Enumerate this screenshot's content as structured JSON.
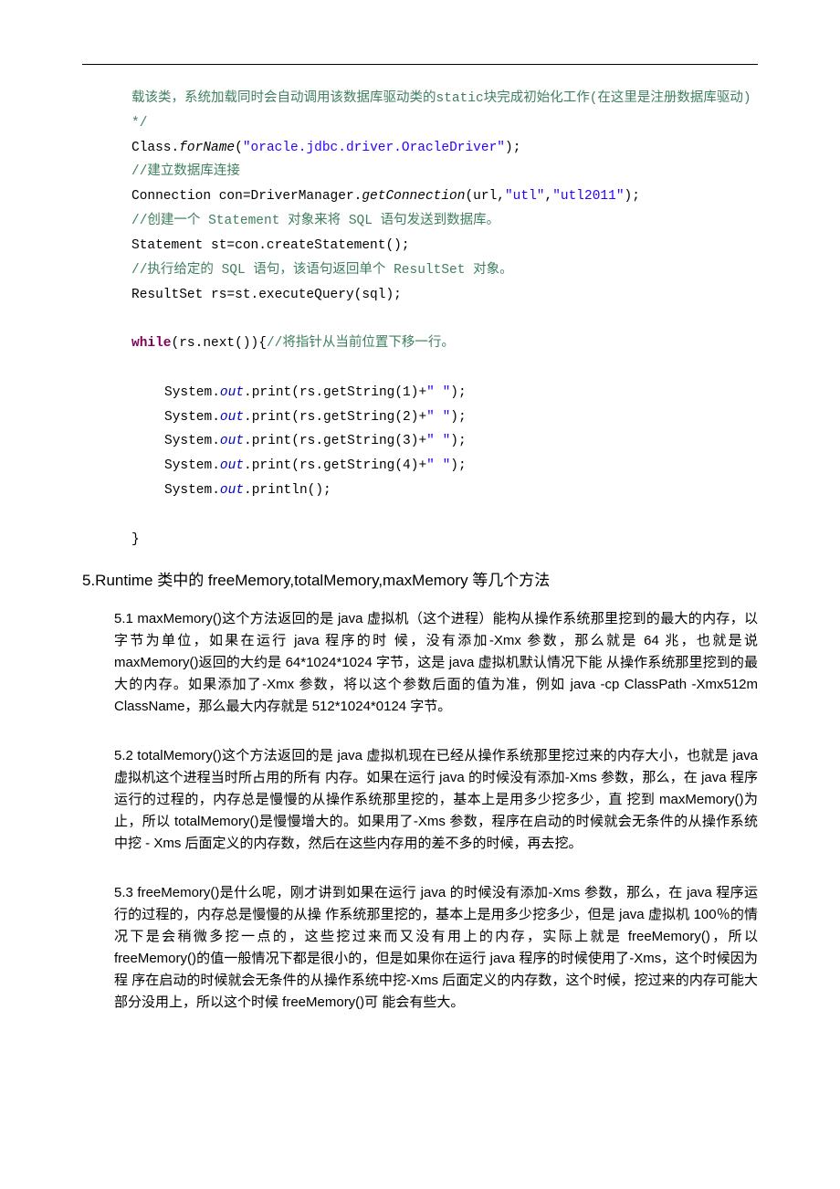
{
  "code": {
    "c1_a": "载该类，系统加载同时会自动调用该数据库驱动类的",
    "c1_b": "static",
    "c1_c": "块完成初始化工作(在这里是注册数据库驱动) */",
    "c2_a": "Class.",
    "c2_b": "forName",
    "c2_c": "(",
    "c2_d": "\"oracle.jdbc.driver.OracleDriver\"",
    "c2_e": ");",
    "c3": "//建立数据库连接",
    "c4_a": "Connection con=DriverManager.",
    "c4_b": "getConnection",
    "c4_c": "(url,",
    "c4_d": "\"utl\"",
    "c4_e": ",",
    "c4_f": "\"utl2011\"",
    "c4_g": ");",
    "c5": "//创建一个 Statement 对象来将 SQL 语句发送到数据库。",
    "c6": "Statement st=con.createStatement();",
    "c7": "//执行给定的 SQL 语句，该语句返回单个 ResultSet 对象。",
    "c8": "ResultSet rs=st.executeQuery(sql);",
    "c9_a": "while",
    "c9_b": "(rs.next()){",
    "c9_c": "//将指针从当前位置下移一行。",
    "c10_a": "System.",
    "c10_b": "out",
    "c10_c": ".print(rs.getString(1)+",
    "c10_d": "\"    \"",
    "c10_e": ");",
    "c11_a": "System.",
    "c11_b": "out",
    "c11_c": ".print(rs.getString(2)+",
    "c11_d": "\"    \"",
    "c11_e": ");",
    "c12_a": "System.",
    "c12_b": "out",
    "c12_c": ".print(rs.getString(3)+",
    "c12_d": "\"    \"",
    "c12_e": ");",
    "c13_a": "System.",
    "c13_b": "out",
    "c13_c": ".print(rs.getString(4)+",
    "c13_d": "\"    \"",
    "c13_e": ");",
    "c14_a": "System.",
    "c14_b": "out",
    "c14_c": ".println();",
    "c15": "}"
  },
  "heading": "5.Runtime 类中的 freeMemory,totalMemory,maxMemory 等几个方法",
  "paras": {
    "p1": "5.1 maxMemory()这个方法返回的是 java 虚拟机（这个进程）能构从操作系统那里挖到的最大的内存，以字节为单位，如果在运行 java 程序的时 候，没有添加-Xmx 参数，那么就是 64 兆，也就是说 maxMemory()返回的大约是 64*1024*1024 字节，这是 java 虚拟机默认情况下能 从操作系统那里挖到的最大的内存。如果添加了-Xmx 参数，将以这个参数后面的值为准，例如 java -cp ClassPath -Xmx512m ClassName，那么最大内存就是 512*1024*0124 字节。",
    "p2": "5.2 totalMemory()这个方法返回的是 java 虚拟机现在已经从操作系统那里挖过来的内存大小，也就是 java 虚拟机这个进程当时所占用的所有 内存。如果在运行 java 的时候没有添加-Xms 参数，那么，在 java 程序运行的过程的，内存总是慢慢的从操作系统那里挖的，基本上是用多少挖多少，直 挖到 maxMemory()为止，所以 totalMemory()是慢慢增大的。如果用了-Xms 参数，程序在启动的时候就会无条件的从操作系统中挖 - Xms 后面定义的内存数，然后在这些内存用的差不多的时候，再去挖。",
    "p3": "5.3 freeMemory()是什么呢，刚才讲到如果在运行 java 的时候没有添加-Xms 参数，那么，在 java 程序运行的过程的，内存总是慢慢的从操 作系统那里挖的，基本上是用多少挖多少，但是 java 虚拟机 100％的情况下是会稍微多挖一点的，这些挖过来而又没有用上的内存，实际上就是 freeMemory()，所以 freeMemory()的值一般情况下都是很小的，但是如果你在运行 java 程序的时候使用了-Xms，这个时候因为程 序在启动的时候就会无条件的从操作系统中挖-Xms 后面定义的内存数，这个时候，挖过来的内存可能大部分没用上，所以这个时候 freeMemory()可 能会有些大。"
  }
}
